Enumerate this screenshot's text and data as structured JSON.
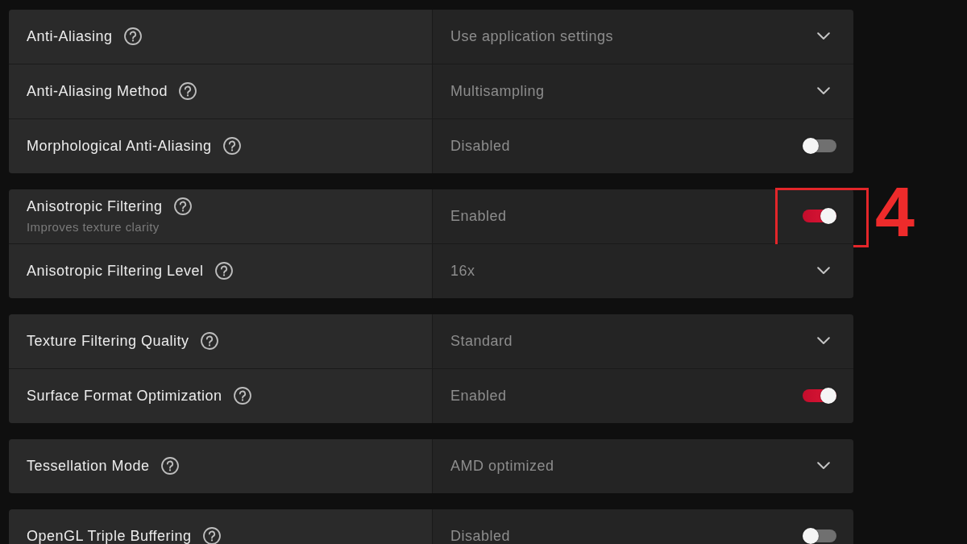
{
  "groups": [
    {
      "settings": [
        {
          "label": "Anti-Aliasing",
          "kind": "dropdown",
          "value": "Use application settings"
        },
        {
          "label": "Anti-Aliasing Method",
          "kind": "dropdown",
          "value": "Multisampling"
        },
        {
          "label": "Morphological Anti-Aliasing",
          "kind": "toggle",
          "value": "Disabled",
          "on": false
        }
      ]
    },
    {
      "settings": [
        {
          "label": "Anisotropic Filtering",
          "description": "Improves texture clarity",
          "kind": "toggle",
          "value": "Enabled",
          "on": true,
          "callout": "4"
        },
        {
          "label": "Anisotropic Filtering Level",
          "kind": "dropdown",
          "value": "16x"
        }
      ]
    },
    {
      "settings": [
        {
          "label": "Texture Filtering Quality",
          "kind": "dropdown",
          "value": "Standard"
        },
        {
          "label": "Surface Format Optimization",
          "kind": "toggle",
          "value": "Enabled",
          "on": true
        }
      ]
    },
    {
      "settings": [
        {
          "label": "Tessellation Mode",
          "kind": "dropdown",
          "value": "AMD optimized"
        }
      ]
    },
    {
      "settings": [
        {
          "label": "OpenGL Triple Buffering",
          "kind": "toggle",
          "value": "Disabled",
          "on": false
        }
      ]
    }
  ]
}
